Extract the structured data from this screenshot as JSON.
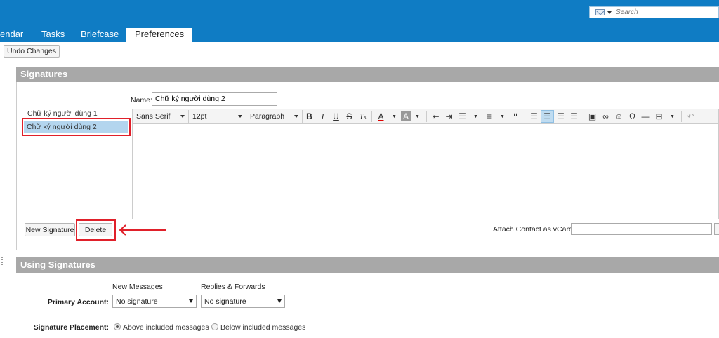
{
  "search": {
    "placeholder": "Search"
  },
  "tabs": [
    {
      "label": "endar"
    },
    {
      "label": "Tasks"
    },
    {
      "label": "Briefcase"
    },
    {
      "label": "Preferences"
    }
  ],
  "undo_label": "Undo Changes",
  "signatures": {
    "title": "Signatures",
    "items": [
      {
        "label": "Chữ ký người dùng 1"
      },
      {
        "label": "Chữ ký người dùng 2"
      }
    ],
    "name_label": "Name:",
    "name_value": "Chữ ký người dùng 2",
    "toolbar": {
      "font_family": "Sans Serif",
      "font_size": "12pt",
      "block_format": "Paragraph"
    },
    "new_button": "New Signature",
    "delete_button": "Delete",
    "vcard_label": "Attach Contact as vCard:"
  },
  "using": {
    "title": "Using Signatures",
    "col_new": "New Messages",
    "col_replies": "Replies & Forwards",
    "primary_label": "Primary Account:",
    "new_value": "No signature",
    "replies_value": "No signature",
    "placement_label": "Signature Placement:",
    "placement_options": [
      {
        "label": "Above included messages",
        "checked": true
      },
      {
        "label": "Below included messages",
        "checked": false
      }
    ]
  },
  "colors": {
    "header_blue": "#0f7cc4",
    "section_gray": "#a8a8a8",
    "selected_row": "#b3d5ee",
    "highlight_red": "#e0202a"
  }
}
